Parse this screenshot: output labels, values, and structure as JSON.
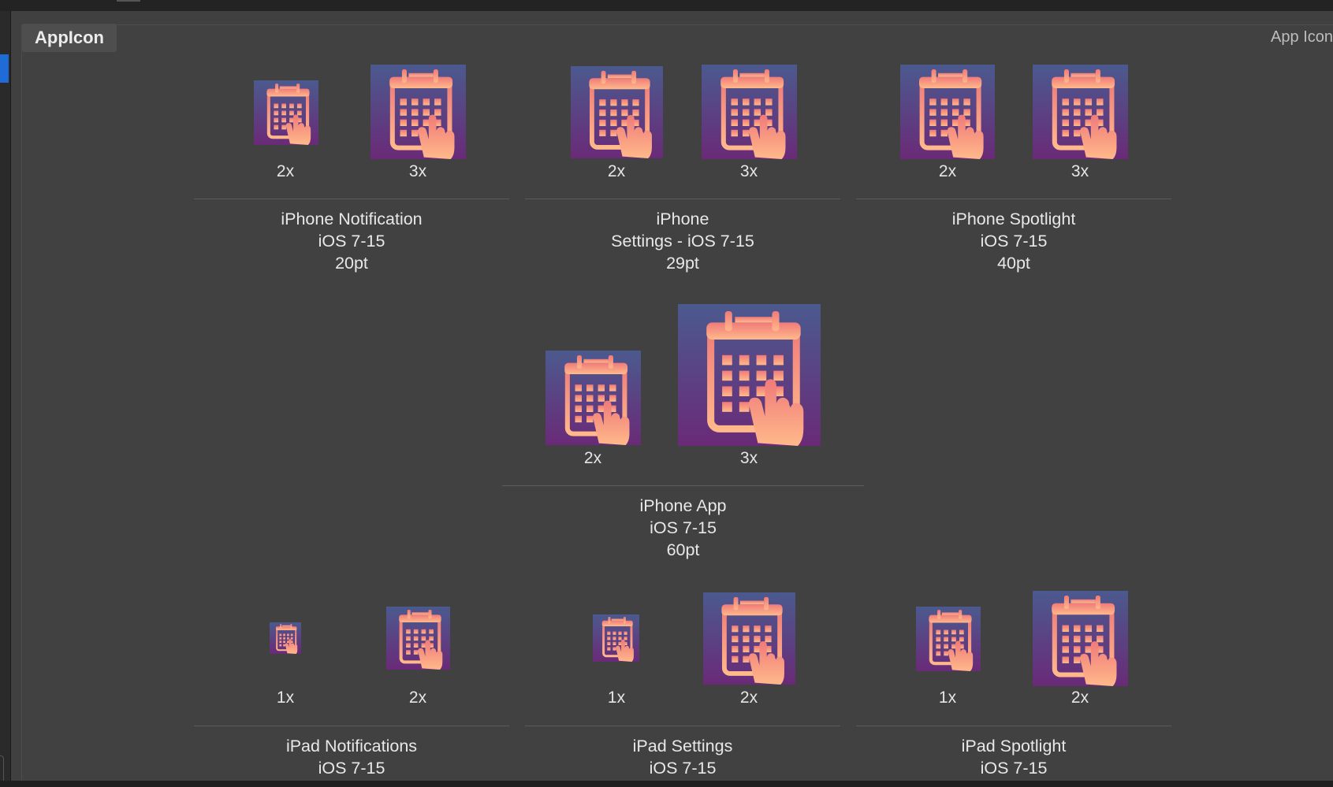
{
  "asset_set": {
    "name": "AppIcon",
    "kind_label": "App Icon"
  },
  "icon_glyph": "calendar-hand-icon",
  "colors": {
    "icon_top": "#4b5a8e",
    "icon_bottom": "#6a2a78",
    "glyph": "#ffb98a"
  },
  "groups": [
    {
      "title": "iPhone Notification",
      "os": "iOS 7-15",
      "size": "20pt",
      "slots": [
        "2x",
        "3x"
      ]
    },
    {
      "title": "iPhone",
      "os": "Settings - iOS 7-15",
      "size": "29pt",
      "slots": [
        "2x",
        "3x"
      ]
    },
    {
      "title": "iPhone Spotlight",
      "os": "iOS 7-15",
      "size": "40pt",
      "slots": [
        "2x",
        "3x"
      ]
    },
    {
      "title": "iPhone App",
      "os": "iOS 7-15",
      "size": "60pt",
      "slots": [
        "2x",
        "3x"
      ]
    },
    {
      "title": "iPad Notifications",
      "os": "iOS 7-15",
      "size": "",
      "slots": [
        "1x",
        "2x"
      ]
    },
    {
      "title": "iPad Settings",
      "os": "iOS 7-15",
      "size": "",
      "slots": [
        "1x",
        "2x"
      ]
    },
    {
      "title": "iPad Spotlight",
      "os": "iOS 7-15",
      "size": "",
      "slots": [
        "1x",
        "2x"
      ]
    }
  ]
}
